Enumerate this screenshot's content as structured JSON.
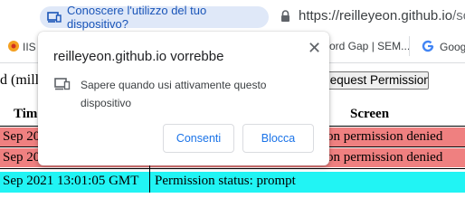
{
  "browser": {
    "permission_chip": "Conoscere l'utilizzo del tuo dispositivo?",
    "url_host": "https://reilleyeon.github.io",
    "url_path": "/scra",
    "bookmarks": [
      "IIS",
      "ord Gap | SEM...",
      "Goog"
    ]
  },
  "page": {
    "prefix_text": "d (mill",
    "request_button": "Request Permission",
    "table": {
      "headers": [
        "Tim",
        "Screen"
      ],
      "rows": [
        {
          "time": "Sep 20",
          "status": "on permission denied",
          "color": "#ef8080"
        },
        {
          "time": "Sep 20",
          "status": "on permission denied",
          "color": "#ef8080"
        },
        {
          "time": "Sep 2021 13:01:05 GMT",
          "status": "Permission status: prompt",
          "color": "#21f4f4"
        }
      ]
    }
  },
  "popup": {
    "title": "reilleyeon.github.io vorrebbe",
    "description": "Sapere quando usi attivamente questo dispositivo",
    "allow_label": "Consenti",
    "block_label": "Blocca",
    "close_glyph": "✕"
  },
  "colors": {
    "accent": "#1a73e8",
    "chip_bg": "#dfe8f8",
    "denied_row": "#ef8080",
    "prompt_row": "#21f4f4"
  }
}
